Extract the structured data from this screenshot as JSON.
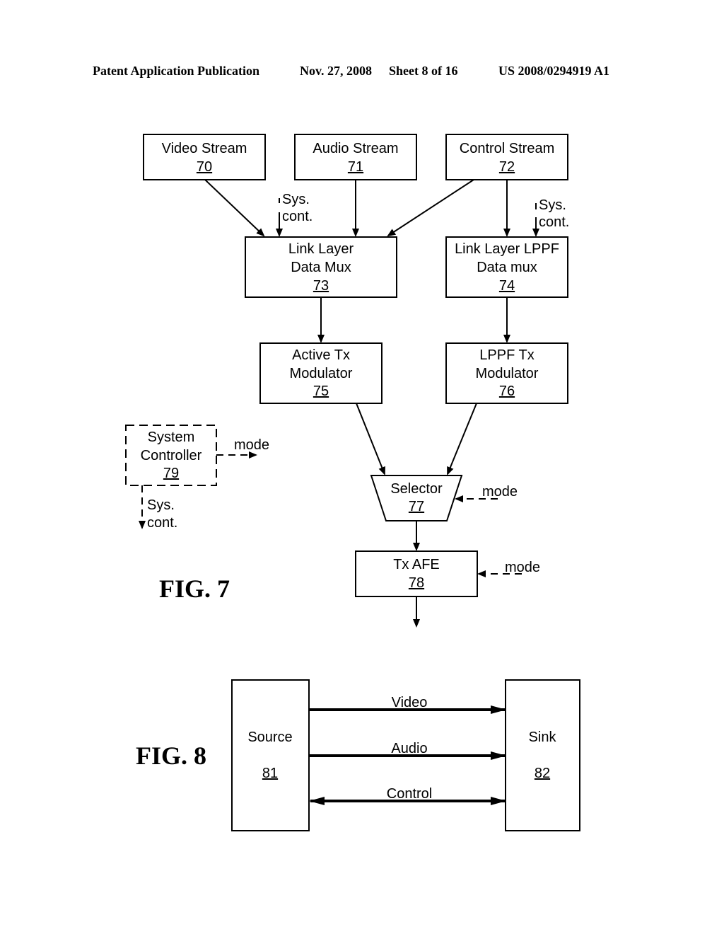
{
  "header": {
    "publication": "Patent Application Publication",
    "date": "Nov. 27, 2008",
    "sheet": "Sheet 8 of 16",
    "number": "US 2008/0294919 A1"
  },
  "fig7": {
    "label": "FIG. 7",
    "blocks": {
      "video_stream": {
        "line1": "Video Stream",
        "ref": "70"
      },
      "audio_stream": {
        "line1": "Audio Stream",
        "ref": "71"
      },
      "control_stream": {
        "line1": "Control Stream",
        "ref": "72"
      },
      "link_layer_mux": {
        "line1": "Link Layer",
        "line2": "Data Mux",
        "ref": "73"
      },
      "lppf_mux": {
        "line1": "Link Layer LPPF",
        "line2": "Data mux",
        "ref": "74"
      },
      "active_tx_mod": {
        "line1": "Active Tx",
        "line2": "Modulator",
        "ref": "75"
      },
      "lppf_tx_mod": {
        "line1": "LPPF Tx",
        "line2": "Modulator",
        "ref": "76"
      },
      "selector": {
        "line1": "Selector",
        "ref": "77"
      },
      "tx_afe": {
        "line1": "Tx AFE",
        "ref": "78"
      },
      "system_controller": {
        "line1": "System",
        "line2": "Controller",
        "ref": "79"
      }
    },
    "signals": {
      "sys": "Sys.",
      "cont": "cont.",
      "mode": "mode"
    }
  },
  "fig8": {
    "label": "FIG. 8",
    "source": {
      "label": "Source",
      "ref": "81"
    },
    "sink": {
      "label": "Sink",
      "ref": "82"
    },
    "links": [
      "Video",
      "Audio",
      "Control"
    ]
  }
}
